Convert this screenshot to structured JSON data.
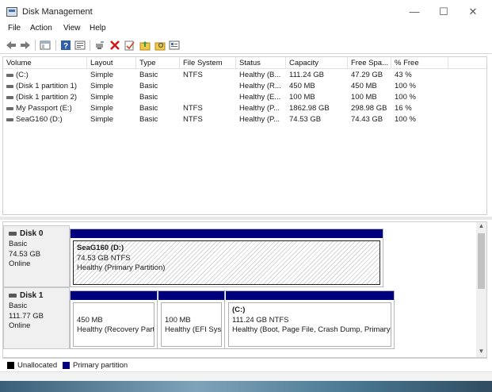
{
  "window": {
    "title": "Disk Management"
  },
  "menu": [
    "File",
    "Action",
    "View",
    "Help"
  ],
  "toolbar": {
    "icons": [
      "back-arrow-icon",
      "forward-arrow-icon",
      "show-hide-console-icon",
      "help-icon",
      "properties-icon",
      "connect-icon",
      "delete-icon",
      "checkmark-icon",
      "folder-up-icon",
      "search-folder-icon",
      "settings-list-icon"
    ]
  },
  "volumes": {
    "headers": [
      "Volume",
      "Layout",
      "Type",
      "File System",
      "Status",
      "Capacity",
      "Free Spa...",
      "% Free"
    ],
    "rows": [
      [
        "(C:)",
        "Simple",
        "Basic",
        "NTFS",
        "Healthy (B...",
        "111.24 GB",
        "47.29 GB",
        "43 %"
      ],
      [
        "(Disk 1 partition 1)",
        "Simple",
        "Basic",
        "",
        "Healthy (R...",
        "450 MB",
        "450 MB",
        "100 %"
      ],
      [
        "(Disk 1 partition 2)",
        "Simple",
        "Basic",
        "",
        "Healthy (E...",
        "100 MB",
        "100 MB",
        "100 %"
      ],
      [
        "My Passport (E:)",
        "Simple",
        "Basic",
        "NTFS",
        "Healthy (P...",
        "1862.98 GB",
        "298.98 GB",
        "16 %"
      ],
      [
        "SeaG160 (D:)",
        "Simple",
        "Basic",
        "NTFS",
        "Healthy (P...",
        "74.53 GB",
        "74.43 GB",
        "100 %"
      ]
    ]
  },
  "disks": [
    {
      "name": "Disk 0",
      "type": "Basic",
      "size": "74.53 GB",
      "state": "Online",
      "partitions": [
        {
          "title": "SeaG160  (D:)",
          "size": "74.53 GB NTFS",
          "status": "Healthy (Primary Partition)"
        }
      ]
    },
    {
      "name": "Disk 1",
      "type": "Basic",
      "size": "111.77 GB",
      "state": "Online",
      "partitions": [
        {
          "title": "",
          "size": "450 MB",
          "status": "Healthy (Recovery Part"
        },
        {
          "title": "",
          "size": "100 MB",
          "status": "Healthy (EFI Syst"
        },
        {
          "title": "(C:)",
          "size": "111.24 GB NTFS",
          "status": "Healthy (Boot, Page File, Crash Dump, Primary"
        }
      ]
    }
  ],
  "legend": [
    {
      "label": "Unallocated",
      "color": "#000000"
    },
    {
      "label": "Primary partition",
      "color": "#00007f"
    }
  ],
  "colors": {
    "primary_partition": "#00007f",
    "unallocated": "#000000"
  }
}
